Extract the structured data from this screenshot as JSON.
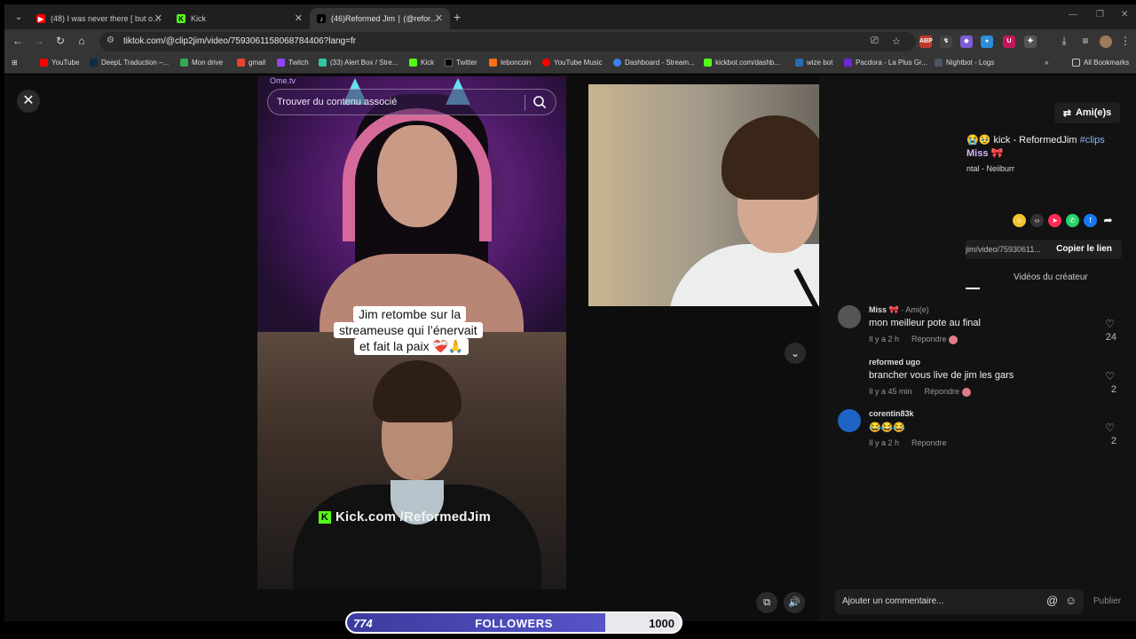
{
  "browser": {
    "tabs": [
      {
        "title": "(48) I was never there [ but only",
        "favicon_color": "#ff0000"
      },
      {
        "title": "Kick",
        "favicon_color": "#53fc18"
      },
      {
        "title": "(46)Reformed Jim ∣ (@reformed",
        "favicon_color": "#ffffff"
      }
    ],
    "url": "tiktok.com/@clip2jim/video/7593061158068784406?lang=fr",
    "bookmarks": [
      {
        "label": "YouTube",
        "color": "#ff0000"
      },
      {
        "label": "DeepL Traduction –...",
        "color": "#0f2b46"
      },
      {
        "label": "Mon drive",
        "color": "#34a853"
      },
      {
        "label": "gmail",
        "color": "#ea4335"
      },
      {
        "label": "Twitch",
        "color": "#9146ff"
      },
      {
        "label": "(33) Alert Box / Stre...",
        "color": "#31c3a2"
      },
      {
        "label": "Kick",
        "color": "#53fc18"
      },
      {
        "label": "Twitter",
        "color": "#000000"
      },
      {
        "label": "leboncoin",
        "color": "#ff6e14"
      },
      {
        "label": "YouTube Music",
        "color": "#ff0000"
      },
      {
        "label": "Dashboard - Stream...",
        "color": "#3b82f6"
      },
      {
        "label": "kickbot.com/dashb...",
        "color": "#53fc18"
      },
      {
        "label": "wize bot",
        "color": "#2b6cb0"
      },
      {
        "label": "Pacdora - La Plus Gr...",
        "color": "#6d28d9"
      },
      {
        "label": "Nightbot - Logs",
        "color": "#4b5563"
      }
    ],
    "all_bookmarks": "All Bookmarks"
  },
  "video": {
    "search_placeholder": "Trouver du contenu associé",
    "caption_lines": [
      "Jim retombe sur la",
      "streameuse qui l’énervait",
      "et fait la paix ❤️‍🩹🙏"
    ],
    "watermark": "Kick.com /ReformedJim",
    "top_label": "Ome.tv"
  },
  "side": {
    "friends_button": "Ami(e)s",
    "desc_line1_prefix": "😭🥹 kick - ReformedJim ",
    "desc_hashtag": "#clips",
    "desc_line2": "Miss 🎀",
    "desc_music": "ntal - Neiiburr",
    "link_text": "jim/video/75930611...",
    "copy_link": "Copier le lien",
    "creator_tab": "Vidéos du créateur"
  },
  "comments": [
    {
      "user": "Miss 🎀",
      "badge": "· Ami(e)",
      "text": "mon meilleur pote au final",
      "time": "Il y a 2 h",
      "reply": "Répondre",
      "likes": "24",
      "avatar_color": "#555555"
    },
    {
      "user": "reformed ugo",
      "badge": "",
      "text": "brancher vous live de jim les gars",
      "time": "Il y a 45 min",
      "reply": "Répondre",
      "likes": "2",
      "avatar_color": "#111111"
    },
    {
      "user": "corentin83k",
      "badge": "",
      "text": "😂😂😂",
      "time": "Il y a 2 h",
      "reply": "Répondre",
      "likes": "2",
      "avatar_color": "#1e63c6"
    }
  ],
  "comment_input": {
    "placeholder": "Ajouter un commentaire...",
    "publish": "Publier"
  },
  "followers": {
    "current": "774",
    "label": "FOLLOWERS",
    "goal": "1000",
    "progress": 0.774
  }
}
